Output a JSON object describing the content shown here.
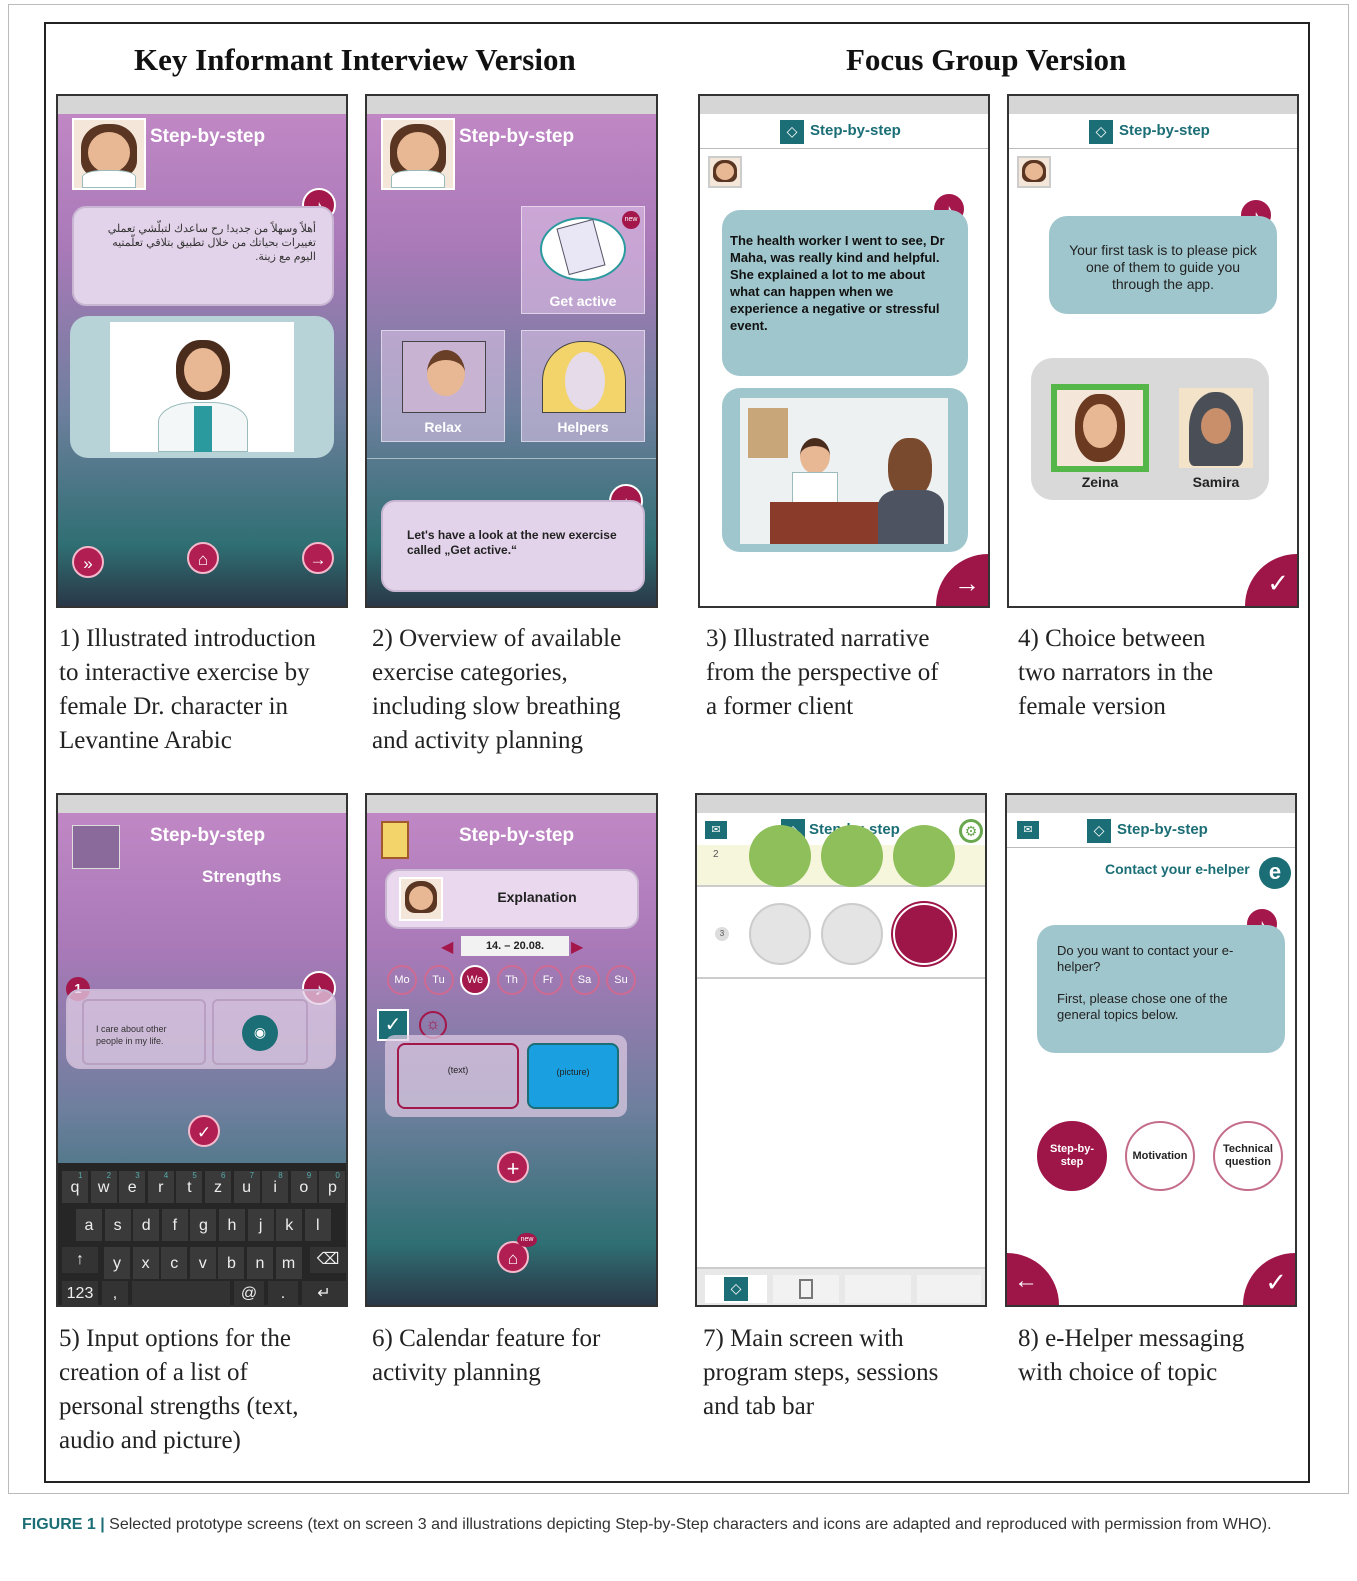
{
  "headings": {
    "left": "Key Informant Interview Version",
    "right": "Focus Group Version"
  },
  "app_title": "Step-by-step",
  "screen1": {
    "arabic_text": "أهلاً وسهلاً من جديد! رح ساعدك لتبلّشي تعملي تغييرات بحياتك من خلال تطبيق بتلاقي تعلّمتيه اليوم مع زينة.",
    "caption": [
      "1) Illustrated introduction",
      "to interactive exercise by",
      "female Dr. character in",
      "Levantine Arabic"
    ]
  },
  "screen2": {
    "tiles": [
      "Get active",
      "Relax",
      "Helpers"
    ],
    "new_badge": "new",
    "message": "Let's have a look at the new exercise called „Get active.“",
    "caption": [
      "2) Overview of available",
      "exercise categories,",
      "including slow breathing",
      "and activity planning"
    ]
  },
  "screen3": {
    "story": "The health worker I went to see, Dr Maha, was really kind and helpful. She explained a lot to me about what can happen when we experience a negative or stressful event.",
    "caption": [
      "3) Illustrated narrative",
      "from the perspective of",
      "a former client"
    ]
  },
  "screen4": {
    "message": "Your first task is to please pick one of them to guide you through the app.",
    "narrators": [
      "Zeina",
      "Samira"
    ],
    "caption": [
      "4) Choice between",
      "two narrators in the",
      "female version"
    ]
  },
  "screen5": {
    "subtitle": "Strengths",
    "badge": "1",
    "input_text": "I care about other people in my life.",
    "keyboard_rows": [
      [
        "q",
        "w",
        "e",
        "r",
        "t",
        "z",
        "u",
        "i",
        "o",
        "p"
      ],
      [
        "a",
        "s",
        "d",
        "f",
        "g",
        "h",
        "j",
        "k",
        "l"
      ],
      [
        "y",
        "x",
        "c",
        "v",
        "b",
        "n",
        "m"
      ]
    ],
    "number_row": [
      "1",
      "2",
      "3",
      "4",
      "5",
      "6",
      "7",
      "8",
      "9",
      "0"
    ],
    "key_123": "123",
    "key_comma": ",",
    "key_at": "@",
    "key_dot": ".",
    "caption": [
      "5) Input options for the",
      "creation of a list of",
      "personal strengths (text,",
      "audio and picture)"
    ]
  },
  "screen6": {
    "panel_title": "Explanation",
    "date_range": "14. – 20.08.",
    "days": [
      "Mo",
      "Tu",
      "We",
      "Th",
      "Fr",
      "Sa",
      "Su"
    ],
    "selected_day": "We",
    "text_box": "(text)",
    "picture_box": "(picture)",
    "new_badge": "new",
    "caption": [
      "6) Calendar feature for",
      "activity planning"
    ]
  },
  "screen7": {
    "step_numbers": [
      "2",
      "3"
    ],
    "caption": [
      "7) Main screen with",
      "program steps, sessions",
      "and tab bar"
    ]
  },
  "screen8": {
    "contact_title": "Contact your e-helper",
    "message_1": "Do you want to contact your e-helper?",
    "message_2": "First, please chose one of the general topics below.",
    "topics": [
      "Step-by-step",
      "Motivation",
      "Technical question"
    ],
    "caption": [
      "8) e-Helper messaging",
      "with choice of topic"
    ]
  },
  "figure_caption": {
    "label": "FIGURE 1 |",
    "text": " Selected prototype screens (text on screen 3 and illustrations depicting Step-by-Step characters and icons are adapted and reproduced with permission from WHO)."
  },
  "colors": {
    "accent": "#a3174a",
    "teal": "#1b6e75",
    "bubble": "#9fc6cc"
  },
  "icons": [
    "speaker-icon",
    "fast-forward-icon",
    "home-icon",
    "arrow-right-icon",
    "check-icon",
    "arrow-left-icon",
    "mail-icon",
    "gear-icon",
    "camera-icon",
    "plus-icon",
    "sun-icon"
  ]
}
